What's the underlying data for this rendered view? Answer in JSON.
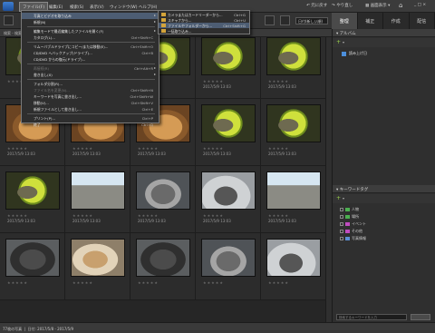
{
  "menubar": {
    "items": [
      "ファイル(F)",
      "編集(E)",
      "検索(S)",
      "表示(V)",
      "ウィンドウ(W)",
      "ヘルプ(H)"
    ],
    "undo": "元に戻す",
    "redo": "やり直し",
    "display": "画面表示"
  },
  "toolbar": {
    "sort_label": "日付(新しい順)"
  },
  "right_tabs": [
    "整理",
    "補正",
    "作成",
    "配信"
  ],
  "path": "検索 - 検索条件: すべてのメディア",
  "file_menu": [
    {
      "label": "写真とビデオを取り込み",
      "shortcut": "",
      "arrow": true,
      "highlighted": true,
      "disabled": false
    },
    {
      "label": "新規(N)",
      "shortcut": "",
      "arrow": true,
      "highlighted": false,
      "disabled": false
    },
    {
      "label": "編集モードで最近編集したファイルを開く(F)",
      "shortcut": "",
      "arrow": true,
      "highlighted": false,
      "disabled": false
    },
    {
      "label": "カタログ(L)...",
      "shortcut": "Ctrl+Shift+C",
      "arrow": false,
      "highlighted": false,
      "disabled": false
    },
    {
      "label": "リムーバブルドライブにコピー/または移動(E)...",
      "shortcut": "Ctrl+Shift+O",
      "arrow": false,
      "highlighted": false,
      "disabled": false
    },
    {
      "label": "CD/DVD へバックアップ(ドライブ)...",
      "shortcut": "Ctrl+B",
      "arrow": false,
      "highlighted": false,
      "disabled": false
    },
    {
      "label": "CD/DVD からの復元(ドライブ)...",
      "shortcut": "",
      "arrow": false,
      "highlighted": false,
      "disabled": false
    },
    {
      "label": "再接続(R)",
      "shortcut": "Ctrl+Alt+R",
      "arrow": true,
      "highlighted": false,
      "disabled": true
    },
    {
      "label": "書き出し(X)",
      "shortcut": "",
      "arrow": true,
      "highlighted": false,
      "disabled": false
    },
    {
      "label": "フォルダ分割(R)...",
      "shortcut": "",
      "arrow": false,
      "highlighted": false,
      "disabled": false
    },
    {
      "label": "ファイル名を変更(N)...",
      "shortcut": "Ctrl+Shift+N",
      "arrow": false,
      "highlighted": false,
      "disabled": true
    },
    {
      "label": "キーワードを写真に書き出し...",
      "shortcut": "Ctrl+Shift+W",
      "arrow": false,
      "highlighted": false,
      "disabled": false
    },
    {
      "label": "移動(V)...",
      "shortcut": "Ctrl+Shift+V",
      "arrow": false,
      "highlighted": false,
      "disabled": false
    },
    {
      "label": "新規ファイルとして書き出し...",
      "shortcut": "Ctrl+E",
      "arrow": false,
      "highlighted": false,
      "disabled": false
    },
    {
      "label": "プリント(P)...",
      "shortcut": "Ctrl+P",
      "arrow": false,
      "highlighted": false,
      "disabled": false
    },
    {
      "label": "終了",
      "shortcut": "Ctrl+Q",
      "arrow": false,
      "highlighted": false,
      "disabled": false
    }
  ],
  "import_submenu": [
    {
      "label": "カメラまたはカードリーダーから...",
      "shortcut": "Ctrl+G",
      "highlighted": false
    },
    {
      "label": "スキャナから...",
      "shortcut": "Ctrl+U",
      "highlighted": false
    },
    {
      "label": "ファイルやフォルダーから...",
      "shortcut": "Ctrl+Shift+G",
      "highlighted": true
    },
    {
      "label": "一括取り込み...",
      "shortcut": "",
      "highlighted": false
    }
  ],
  "photos": [
    {
      "style": "p-yellow",
      "date": ""
    },
    {
      "style": "p-gray",
      "date": ""
    },
    {
      "style": "p-yellow",
      "date": ""
    },
    {
      "style": "p-yellow",
      "date": "2017/5/9 13:03"
    },
    {
      "style": "p-yellow",
      "date": "2017/5/9 13:03"
    },
    {
      "style": "p-orange",
      "date": "2017/5/9 13:03"
    },
    {
      "style": "p-orange",
      "date": "2017/5/9 13:03"
    },
    {
      "style": "p-orange",
      "date": "2017/5/9 13:03"
    },
    {
      "style": "p-yellow",
      "date": "2017/5/9 13:03"
    },
    {
      "style": "p-yellow",
      "date": "2017/5/9 13:03"
    },
    {
      "style": "p-yellow",
      "date": "2017/5/9 13:03"
    },
    {
      "style": "p-window",
      "date": "2017/5/9 13:03"
    },
    {
      "style": "p-gray",
      "date": "2017/5/9 13:03"
    },
    {
      "style": "p-light",
      "date": "2017/5/9 13:03"
    },
    {
      "style": "p-window",
      "date": "2017/5/9 13:03"
    },
    {
      "style": "p-dark",
      "date": ""
    },
    {
      "style": "p-tan",
      "date": ""
    },
    {
      "style": "p-dark",
      "date": ""
    },
    {
      "style": "p-gray",
      "date": ""
    },
    {
      "style": "p-light",
      "date": ""
    }
  ],
  "panel": {
    "albums_title": "アルバム",
    "album_item": "読み上げ日",
    "keywords_title": "キーワードタグ",
    "tags": [
      {
        "label": "人物",
        "color": "#4caf50"
      },
      {
        "label": "場所",
        "color": "#4caf50"
      },
      {
        "label": "イベント",
        "color": "#c04cc0"
      },
      {
        "label": "その他",
        "color": "#c04cc0"
      },
      {
        "label": "写真情報",
        "color": "#5b8fd4"
      }
    ],
    "search_placeholder": "検索するキーワードを入力"
  },
  "status": {
    "count": "77枚の写真",
    "range": "日付: 2017/5/8 - 2017/5/9"
  }
}
